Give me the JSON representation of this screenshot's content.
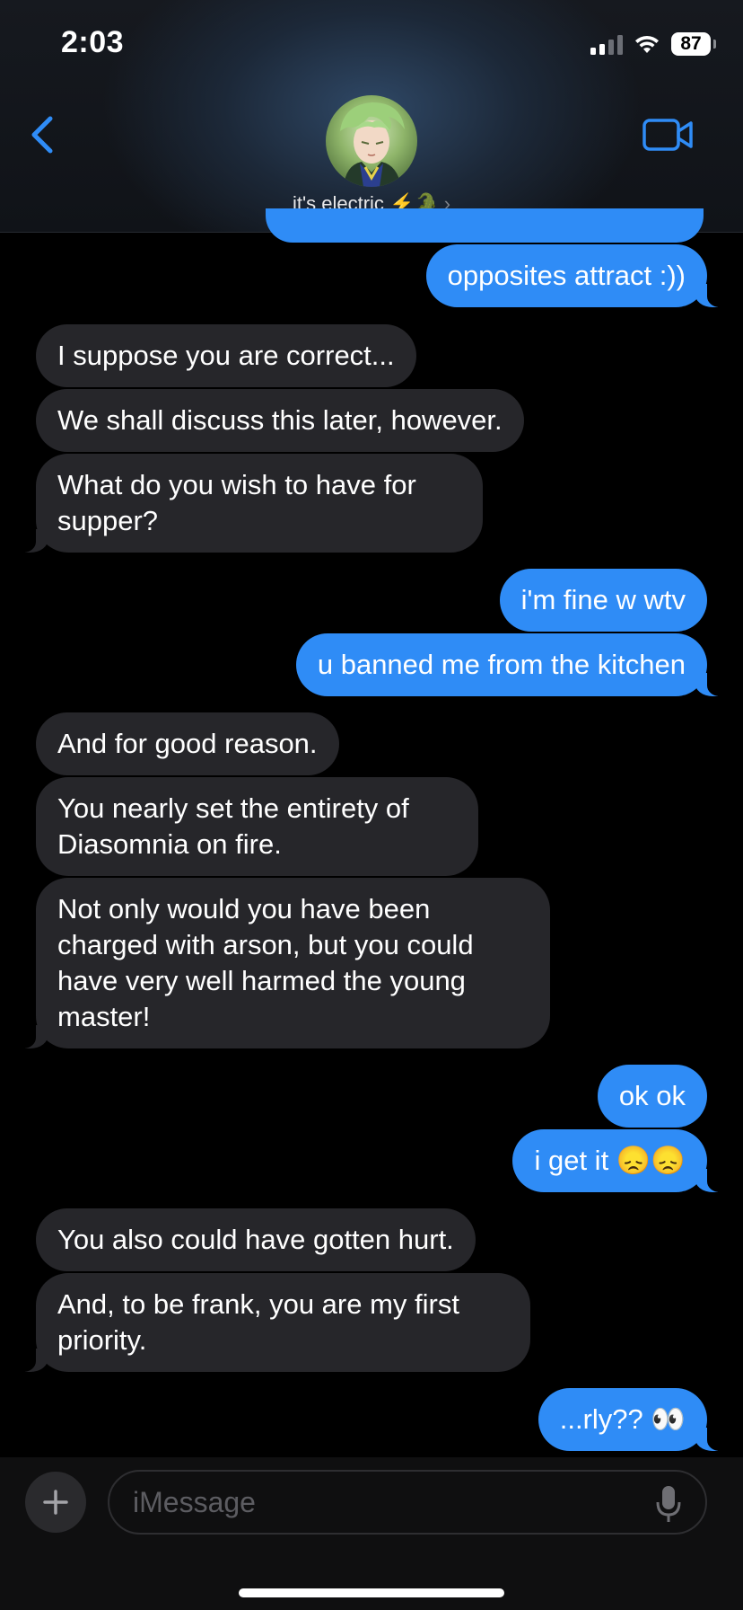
{
  "status_bar": {
    "time": "2:03",
    "battery": "87"
  },
  "header": {
    "contact_name": "it's electric",
    "name_emoji": "⚡🐊",
    "chevron": "›",
    "back_icon": "chevron-left-icon",
    "video_icon": "video-camera-icon"
  },
  "colors": {
    "accent": "#2f8cf6",
    "incoming_bubble": "#26262a",
    "background": "#000000"
  },
  "messages": [
    {
      "from": "me",
      "text": "opposites attract :))"
    },
    {
      "from": "them",
      "text": "I suppose you are correct..."
    },
    {
      "from": "them",
      "text": "We shall discuss this later, however."
    },
    {
      "from": "them",
      "text": "What do you wish to have for supper?"
    },
    {
      "from": "me",
      "text": "i'm fine w wtv"
    },
    {
      "from": "me",
      "text": "u banned me from the kitchen"
    },
    {
      "from": "them",
      "text": "And for good reason."
    },
    {
      "from": "them",
      "text": "You nearly set the entirety of Diasomnia on fire."
    },
    {
      "from": "them",
      "text": "Not only would you have been charged with arson, but you could have very well harmed the young master!"
    },
    {
      "from": "me",
      "text": "ok ok"
    },
    {
      "from": "me",
      "text": "i get it 😞😞"
    },
    {
      "from": "them",
      "text": "You also could have gotten hurt."
    },
    {
      "from": "them",
      "text": "And, to be frank, you are my first priority."
    },
    {
      "from": "me",
      "text": "...rly?? 👀"
    }
  ],
  "input": {
    "placeholder": "iMessage",
    "value": ""
  }
}
